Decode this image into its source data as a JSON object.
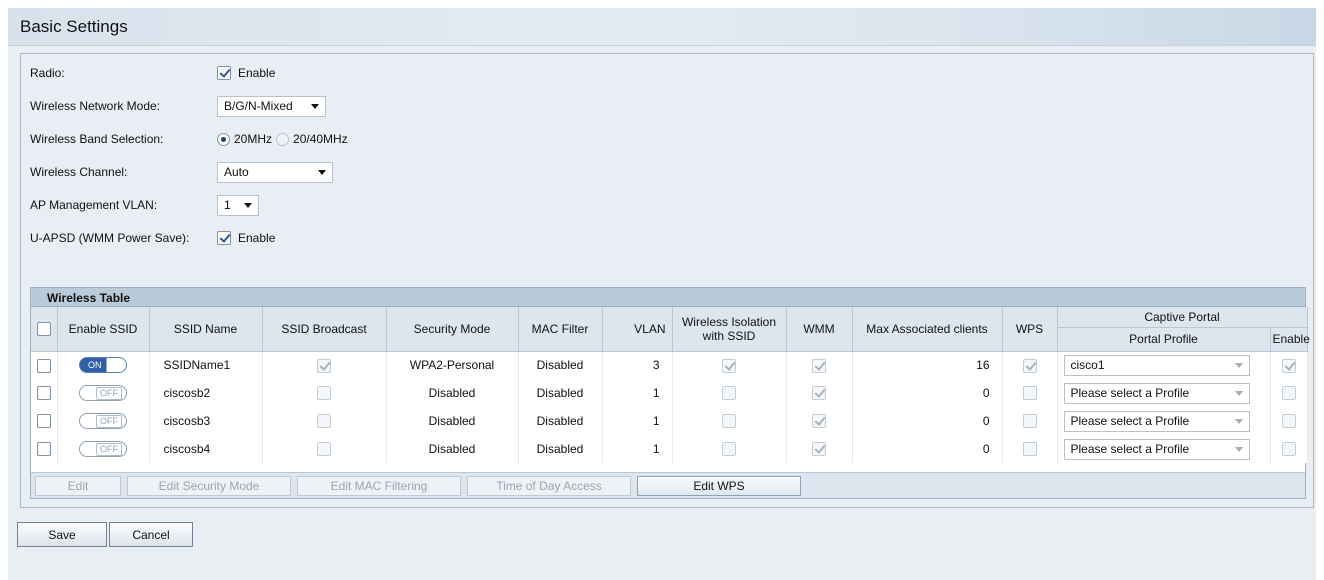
{
  "page": {
    "title": "Basic Settings"
  },
  "settings": {
    "radio": {
      "label": "Radio:",
      "checkbox_label": "Enable",
      "checked": true
    },
    "network_mode": {
      "label": "Wireless Network Mode:",
      "value": "B/G/N-Mixed"
    },
    "band": {
      "label": "Wireless Band Selection:",
      "option1": "20MHz",
      "option2": "20/40MHz",
      "selected": "20MHz"
    },
    "channel": {
      "label": "Wireless Channel:",
      "value": "Auto"
    },
    "vlan": {
      "label": "AP Management VLAN:",
      "value": "1"
    },
    "uapsd": {
      "label": "U-APSD (WMM Power Save):",
      "checkbox_label": "Enable",
      "checked": true
    }
  },
  "table": {
    "title": "Wireless Table",
    "headers": {
      "enable_ssid": "Enable SSID",
      "ssid_name": "SSID Name",
      "ssid_broadcast": "SSID Broadcast",
      "security_mode": "Security Mode",
      "mac_filter": "MAC Filter",
      "vlan": "VLAN",
      "isolation": "Wireless Isolation with SSID",
      "wmm": "WMM",
      "max_clients": "Max Associated clients",
      "wps": "WPS",
      "captive_portal": "Captive Portal",
      "portal_profile": "Portal Profile",
      "enable": "Enable"
    },
    "rows": [
      {
        "toggle": "ON",
        "ssid": "SSIDName1",
        "security": "WPA2-Personal",
        "mac": "Disabled",
        "vlan": "3",
        "max": "16",
        "profile": "cisco1"
      },
      {
        "toggle": "OFF",
        "ssid": "ciscosb2",
        "security": "Disabled",
        "mac": "Disabled",
        "vlan": "1",
        "max": "0",
        "profile": "Please select a Profile"
      },
      {
        "toggle": "OFF",
        "ssid": "ciscosb3",
        "security": "Disabled",
        "mac": "Disabled",
        "vlan": "1",
        "max": "0",
        "profile": "Please select a Profile"
      },
      {
        "toggle": "OFF",
        "ssid": "ciscosb4",
        "security": "Disabled",
        "mac": "Disabled",
        "vlan": "1",
        "max": "0",
        "profile": "Please select a Profile"
      }
    ],
    "buttons": {
      "edit": "Edit",
      "edit_security": "Edit Security Mode",
      "edit_mac": "Edit MAC Filtering",
      "time_of_day": "Time of Day Access",
      "edit_wps": "Edit WPS"
    }
  },
  "actions": {
    "save": "Save",
    "cancel": "Cancel"
  },
  "colors": {
    "header_bg": "#d7e2ec",
    "panel_bg": "#e9eef4",
    "table_title_bg": "#b9cad9",
    "toggle_on": "#2f5fa8"
  },
  "icons": {
    "dropdown": "chevron-down-icon",
    "checkbox": "checkbox-icon",
    "radio": "radio-icon"
  }
}
